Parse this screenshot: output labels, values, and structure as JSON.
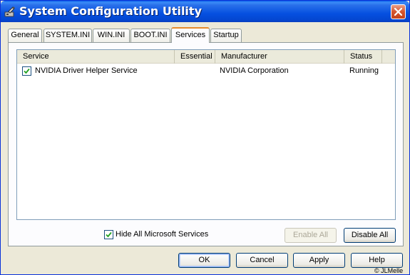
{
  "window": {
    "title": "System Configuration Utility"
  },
  "tabs": [
    {
      "label": "General",
      "active": false
    },
    {
      "label": "SYSTEM.INI",
      "active": false
    },
    {
      "label": "WIN.INI",
      "active": false
    },
    {
      "label": "BOOT.INI",
      "active": false
    },
    {
      "label": "Services",
      "active": true
    },
    {
      "label": "Startup",
      "active": false
    }
  ],
  "services": {
    "columns": [
      "Service",
      "Essential",
      "Manufacturer",
      "Status"
    ],
    "rows": [
      {
        "checked": true,
        "service": "NVIDIA Driver Helper Service",
        "essential": "",
        "manufacturer": "NVIDIA Corporation",
        "status": "Running"
      }
    ]
  },
  "hide_ms": {
    "label": "Hide All Microsoft Services",
    "checked": true
  },
  "buttons": {
    "enable_all": "Enable All",
    "disable_all": "Disable All",
    "ok": "OK",
    "cancel": "Cancel",
    "apply": "Apply",
    "help": "Help"
  },
  "watermark": "© JLMelle",
  "colors": {
    "title_bar": "#0550e0",
    "active_tab_accent": "#e68b2c",
    "close_button": "#d5542d"
  },
  "icons": {
    "title": "system-config-icon",
    "close": "close-icon",
    "checkbox": "checkmark-icon"
  }
}
